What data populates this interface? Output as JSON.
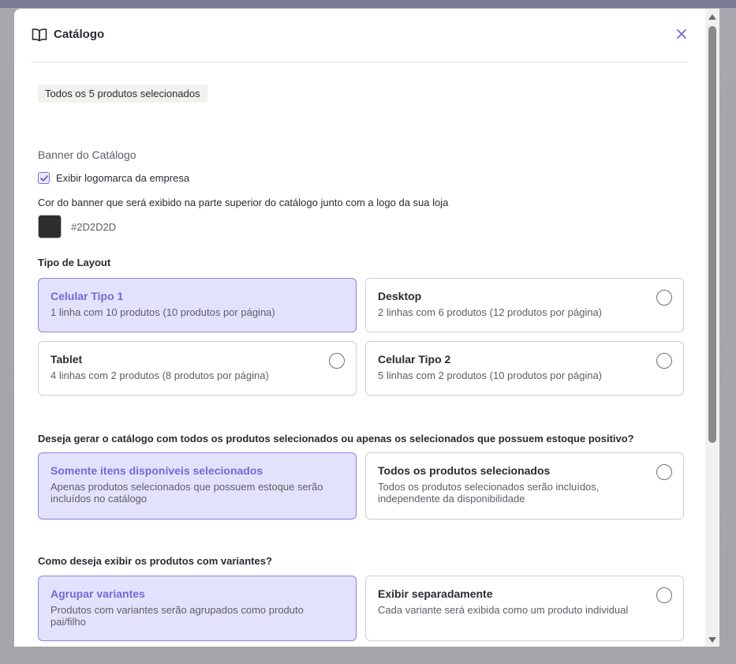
{
  "modal": {
    "title": "Catálogo",
    "selected_badge": "Todos os 5 produtos selecionados"
  },
  "banner": {
    "section_label": "Banner do Catálogo",
    "show_logo_label": "Exibir logomarca da empresa",
    "show_logo_checked": true,
    "color_description": "Cor do banner que será exibido na parte superior do catálogo junto com a logo da sua loja",
    "color_value": "#2D2D2D"
  },
  "layout": {
    "label": "Tipo de Layout",
    "options": [
      {
        "title": "Celular Tipo 1",
        "subtitle": "1 linha com 10 produtos (10 produtos por página)",
        "selected": true
      },
      {
        "title": "Desktop",
        "subtitle": "2 linhas com 6 produtos (12 produtos por página)",
        "selected": false
      },
      {
        "title": "Tablet",
        "subtitle": "4 linhas com 2 produtos (8 produtos por página)",
        "selected": false
      },
      {
        "title": "Celular Tipo 2",
        "subtitle": "5 linhas com 2 produtos (10 produtos por página)",
        "selected": false
      }
    ]
  },
  "stock": {
    "label": "Deseja gerar o catálogo com todos os produtos selecionados ou apenas os selecionados que possuem estoque positivo?",
    "options": [
      {
        "title": "Somente itens disponíveis selecionados",
        "subtitle": "Apenas produtos selecionados que possuem estoque serão incluídos no catálogo",
        "selected": true
      },
      {
        "title": "Todos os produtos selecionados",
        "subtitle": "Todos os produtos selecionados serão incluídos, independente da disponibilidade",
        "selected": false
      }
    ]
  },
  "variants": {
    "label": "Como deseja exibir os produtos com variantes?",
    "options": [
      {
        "title": "Agrupar variantes",
        "subtitle": "Produtos com variantes serão agrupados como produto pai/filho",
        "selected": true
      },
      {
        "title": "Exibir separadamente",
        "subtitle": "Cada variante será exibida como um produto individual",
        "selected": false
      }
    ]
  },
  "colors": {
    "accent": "#7668d9",
    "selected_bg": "#e2e2fd"
  }
}
